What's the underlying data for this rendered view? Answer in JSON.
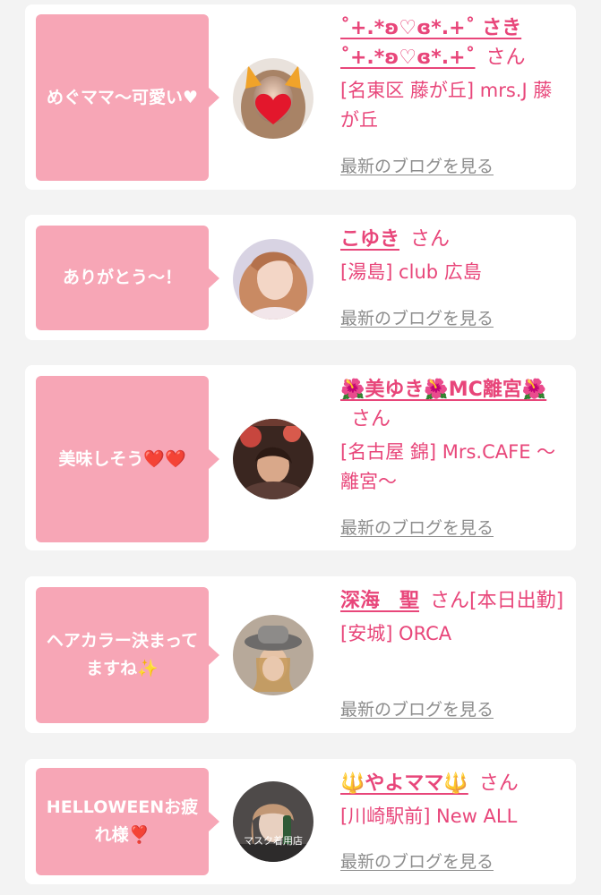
{
  "colors": {
    "accent": "#e8467a",
    "bubble": "#f7a6b6",
    "card": "#ffffff",
    "page_background": "#f3f3f3",
    "muted_link": "#8c8c8c"
  },
  "items": [
    {
      "comment": "めぐママ〜可愛い♥",
      "name": "˚+.*ʚ♡ɞ*.+˚ さき˚+.*ʚ♡ɞ*.+˚",
      "san": "さん",
      "location": "[名東区 藤が丘] mrs.J 藤が丘",
      "blog_link": "最新のブログを見る",
      "avatar_icon": "profile-photo-heart-sticker"
    },
    {
      "comment": "ありがとう〜！",
      "name": "こゆき",
      "san": "さん",
      "location": "[湯島] club 広島",
      "blog_link": "最新のブログを見る",
      "avatar_icon": "profile-photo"
    },
    {
      "comment": "美味しそう❤️❤️",
      "name": "🌺美ゆき🌺MC離宮🌺",
      "san": "さん",
      "location": "[名古屋 錦] Mrs.CAFE 〜離宮〜",
      "blog_link": "最新のブログを見る",
      "avatar_icon": "profile-photo"
    },
    {
      "comment": "ヘアカラー決まってますね✨",
      "name": "深海　聖",
      "san": "さん[本日出勤]",
      "location": "[安城] ORCA",
      "blog_link": "最新のブログを見る",
      "avatar_icon": "profile-photo"
    },
    {
      "comment": "HELLOWEENお疲れ様❣️",
      "name": "🔱やよママ🔱",
      "san": "さん",
      "location": "[川崎駅前] New ALL",
      "blog_link": "最新のブログを見る",
      "avatar_icon": "profile-photo",
      "avatar_caption": "マスク着用店"
    }
  ]
}
